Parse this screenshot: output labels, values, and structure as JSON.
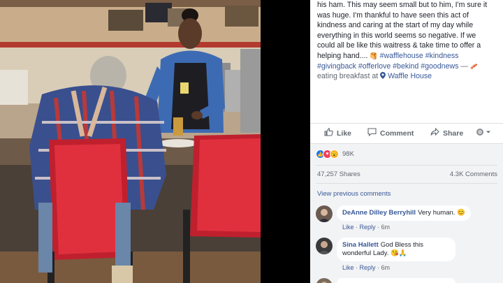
{
  "post": {
    "text_line1": "his ham. This may seem small but to him, I'm sure it",
    "text_line2": "was huge. I'm thankful to have seen this act of",
    "text_line3": "kindness and caring at the start of my day while",
    "text_line4": "everything in this world seems so negative. If we",
    "text_line5": "could all be like this waitress & take time to offer a",
    "text_line6_start": "helping hand.... ",
    "tags_line6": "#wafflehouse #kindness",
    "tags_line7": "#givingback #offerlove #bekind #goodnews",
    "dash": " — ",
    "feeling_prefix": "eating breakfast at ",
    "place": "Waffle House"
  },
  "actions": {
    "like": "Like",
    "comment": "Comment",
    "share": "Share"
  },
  "stats": {
    "reaction_count": "98K",
    "shares": "47,257 Shares",
    "comments": "4.3K Comments"
  },
  "view_previous": "View previous comments",
  "comments": [
    {
      "name": "DeAnne Dilley Berryhill",
      "text": "Very human.",
      "emoji": "😊",
      "like": "Like",
      "reply": "Reply",
      "time": "6m"
    },
    {
      "name": "Sina Hallett",
      "text": "God Bless this wonderful Lady.",
      "emoji": "😘🙏",
      "like": "Like",
      "reply": "Reply",
      "time": "6m"
    }
  ],
  "icons": {
    "like": "thumbs-up-icon",
    "comment": "speech-bubble-icon",
    "share": "share-arrow-icon",
    "more": "globe-audience-icon",
    "place": "location-pin-icon"
  },
  "colors": {
    "link": "#385898",
    "text": "#1d2129",
    "meta": "#606770",
    "comment_bg": "#f2f3f5"
  }
}
